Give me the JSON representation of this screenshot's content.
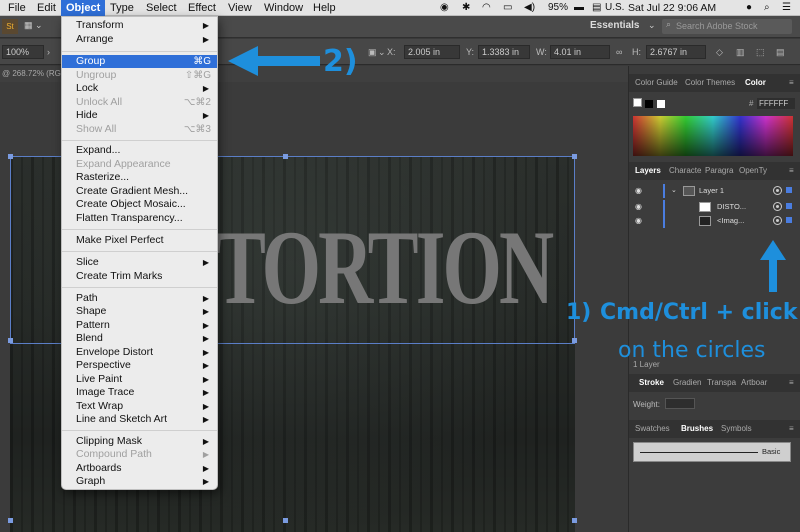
{
  "menubar": {
    "items": [
      "File",
      "Edit",
      "Object",
      "Type",
      "Select",
      "Effect",
      "View",
      "Window",
      "Help"
    ],
    "battery": "95%",
    "locale": "U.S.",
    "clock": "Sat Jul 22  9:06 AM"
  },
  "appbar": {
    "workspace": "Essentials",
    "search_placeholder": "Search Adobe Stock"
  },
  "controlbar": {
    "zoom": "100%",
    "x_value": "2.005 in",
    "y_label": "Y:",
    "y_value": "1.3383 in",
    "w_label": "W:",
    "w_value": "4.01 in",
    "h_label": "H:",
    "h_value": "2.6767 in"
  },
  "doc": {
    "tab_label": "@ 268.72% (RGB",
    "artwork_text": "TORTION"
  },
  "object_menu": {
    "items": [
      {
        "label": "Transform",
        "submenu": true
      },
      {
        "label": "Arrange",
        "submenu": true
      },
      {
        "label": "Group",
        "shortcut": "⌘G",
        "highlighted": true
      },
      {
        "label": "Ungroup",
        "shortcut": "⇧⌘G",
        "disabled": true
      },
      {
        "label": "Lock",
        "submenu": true
      },
      {
        "label": "Unlock All",
        "shortcut": "⌥⌘2",
        "disabled": true
      },
      {
        "label": "Hide",
        "submenu": true
      },
      {
        "label": "Show All",
        "shortcut": "⌥⌘3",
        "disabled": true
      },
      {
        "label": "Expand..."
      },
      {
        "label": "Expand Appearance",
        "disabled": true
      },
      {
        "label": "Rasterize..."
      },
      {
        "label": "Create Gradient Mesh..."
      },
      {
        "label": "Create Object Mosaic..."
      },
      {
        "label": "Flatten Transparency..."
      },
      {
        "label": "Make Pixel Perfect"
      },
      {
        "label": "Slice",
        "submenu": true
      },
      {
        "label": "Create Trim Marks"
      },
      {
        "label": "Path",
        "submenu": true
      },
      {
        "label": "Shape",
        "submenu": true
      },
      {
        "label": "Pattern",
        "submenu": true
      },
      {
        "label": "Blend",
        "submenu": true
      },
      {
        "label": "Envelope Distort",
        "submenu": true
      },
      {
        "label": "Perspective",
        "submenu": true
      },
      {
        "label": "Live Paint",
        "submenu": true
      },
      {
        "label": "Image Trace",
        "submenu": true
      },
      {
        "label": "Text Wrap",
        "submenu": true
      },
      {
        "label": "Line and Sketch Art",
        "submenu": true
      },
      {
        "label": "Clipping Mask",
        "submenu": true
      },
      {
        "label": "Compound Path",
        "submenu": true,
        "disabled": true
      },
      {
        "label": "Artboards",
        "submenu": true
      },
      {
        "label": "Graph",
        "submenu": true
      }
    ]
  },
  "panels": {
    "color_tabs": [
      "Color Guide",
      "Color Themes",
      "Color"
    ],
    "hex_value": "FFFFFF",
    "layer_tabs": [
      "Layers",
      "Characte",
      "Paragra",
      "OpenTy"
    ],
    "layer1": "Layer 1",
    "sublayers": [
      "DISTO...",
      "<Imag..."
    ],
    "layer_count": "1 Layer",
    "stroke_tabs": [
      "Stroke",
      "Gradien",
      "Transpa",
      "Artboar"
    ],
    "weight_label": "Weight:",
    "brush_tabs": [
      "Swatches",
      "Brushes",
      "Symbols"
    ],
    "brush_name": "Basic"
  },
  "annotations": {
    "step2": "2)",
    "step1_num": "1)",
    "step1_line1": "Cmd/Ctrl + click",
    "step1_line2": "on the circles",
    "color": "#1e8fdc"
  }
}
